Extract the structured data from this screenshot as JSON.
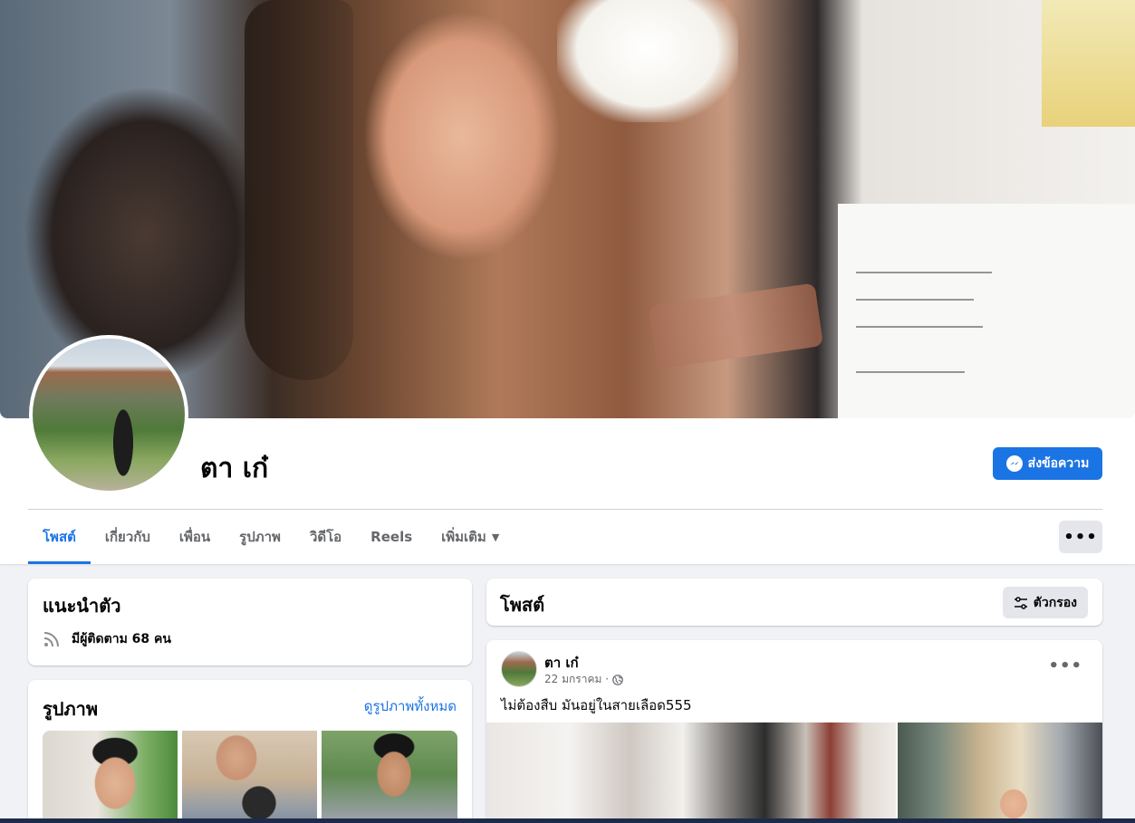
{
  "profile": {
    "name": "ตา เก๋",
    "message_button": "ส่งข้อความ"
  },
  "tabs": [
    {
      "label": "โพสต์",
      "active": true
    },
    {
      "label": "เกี่ยวกับ",
      "active": false
    },
    {
      "label": "เพื่อน",
      "active": false
    },
    {
      "label": "รูปภาพ",
      "active": false
    },
    {
      "label": "วิดีโอ",
      "active": false
    },
    {
      "label": "Reels",
      "active": false
    },
    {
      "label": "เพิ่มเติม",
      "active": false
    }
  ],
  "more_menu": "•••",
  "intro": {
    "title": "แนะนำตัว",
    "followers": "มีผู้ติดตาม 68 คน"
  },
  "photos": {
    "title": "รูปภาพ",
    "see_all": "ดูรูปภาพทั้งหมด"
  },
  "posts": {
    "title": "โพสต์",
    "filter_label": "ตัวกรอง"
  },
  "post": {
    "author": "ตา เก๋",
    "date": "22 มกราคม ·",
    "text": "ไม่ต้องสืบ มันอยู่ในสายเลือด555",
    "menu": "•••"
  },
  "colors": {
    "accent": "#1b74e4",
    "background": "#f0f2f5",
    "secondary_text": "#65676b"
  },
  "icons": {
    "messenger": "messenger-icon",
    "rss": "rss-icon",
    "filter": "filter-icon",
    "globe": "globe-icon",
    "caret": "caret-down-icon"
  }
}
